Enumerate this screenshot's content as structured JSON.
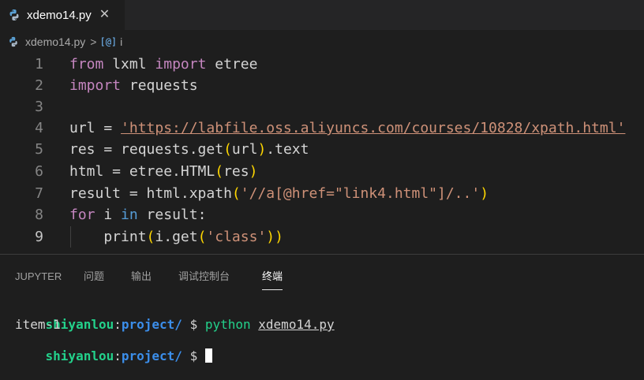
{
  "tab": {
    "filename": "xdemo14.py",
    "close_glyph": "✕"
  },
  "breadcrumb": {
    "file": "xdemo14.py",
    "separator": ">",
    "symbol_icon": "[@]",
    "symbol": "i"
  },
  "editor": {
    "lines": [
      {
        "num": "1",
        "parts": [
          [
            "kw2",
            "from"
          ],
          [
            "txt",
            " lxml "
          ],
          [
            "kw2",
            "import"
          ],
          [
            "txt",
            " etree"
          ]
        ]
      },
      {
        "num": "2",
        "parts": [
          [
            "kw2",
            "import"
          ],
          [
            "txt",
            " requests"
          ]
        ]
      },
      {
        "num": "3",
        "parts": []
      },
      {
        "num": "4",
        "parts": [
          [
            "txt",
            "url = "
          ],
          [
            "str",
            "'https://labfile.oss.aliyuncs.com/courses/10828/xpath.html'"
          ]
        ]
      },
      {
        "num": "5",
        "parts": [
          [
            "txt",
            "res = requests.get"
          ],
          [
            "br1",
            "("
          ],
          [
            "txt",
            "url"
          ],
          [
            "br1",
            ")"
          ],
          [
            "txt",
            ".text"
          ]
        ]
      },
      {
        "num": "6",
        "parts": [
          [
            "txt",
            "html = etree.HTML"
          ],
          [
            "br1",
            "("
          ],
          [
            "txt",
            "res"
          ],
          [
            "br1",
            ")"
          ]
        ]
      },
      {
        "num": "7",
        "parts": [
          [
            "txt",
            "result = html.xpath"
          ],
          [
            "br1",
            "("
          ],
          [
            "str",
            "'//a[@href=\"link4.html\"]/..'"
          ],
          [
            "br1",
            ")"
          ]
        ]
      },
      {
        "num": "8",
        "parts": [
          [
            "kw2",
            "for"
          ],
          [
            "txt",
            " i "
          ],
          [
            "kw",
            "in"
          ],
          [
            "txt",
            " result:"
          ]
        ]
      },
      {
        "num": "9",
        "parts": [
          [
            "txt",
            "    print"
          ],
          [
            "br1",
            "("
          ],
          [
            "txt",
            "i.get"
          ],
          [
            "br1",
            "("
          ],
          [
            "str",
            "'class'"
          ],
          [
            "br1",
            "))"
          ]
        ]
      }
    ]
  },
  "panel": {
    "tabs": [
      "JUPYTER",
      "问题",
      "输出",
      "调试控制台",
      "终端"
    ],
    "active_tab": "终端"
  },
  "terminal": {
    "user": "shiyanlou",
    "colon": ":",
    "path": "project/",
    "dollar": " $ ",
    "command": "python",
    "argument": "xdemo14.py",
    "output": "item-1"
  },
  "colors": {
    "accent": "#569cd6",
    "string": "#ce9178",
    "terminal_green": "#23d18b",
    "terminal_blue": "#3b8eea"
  }
}
